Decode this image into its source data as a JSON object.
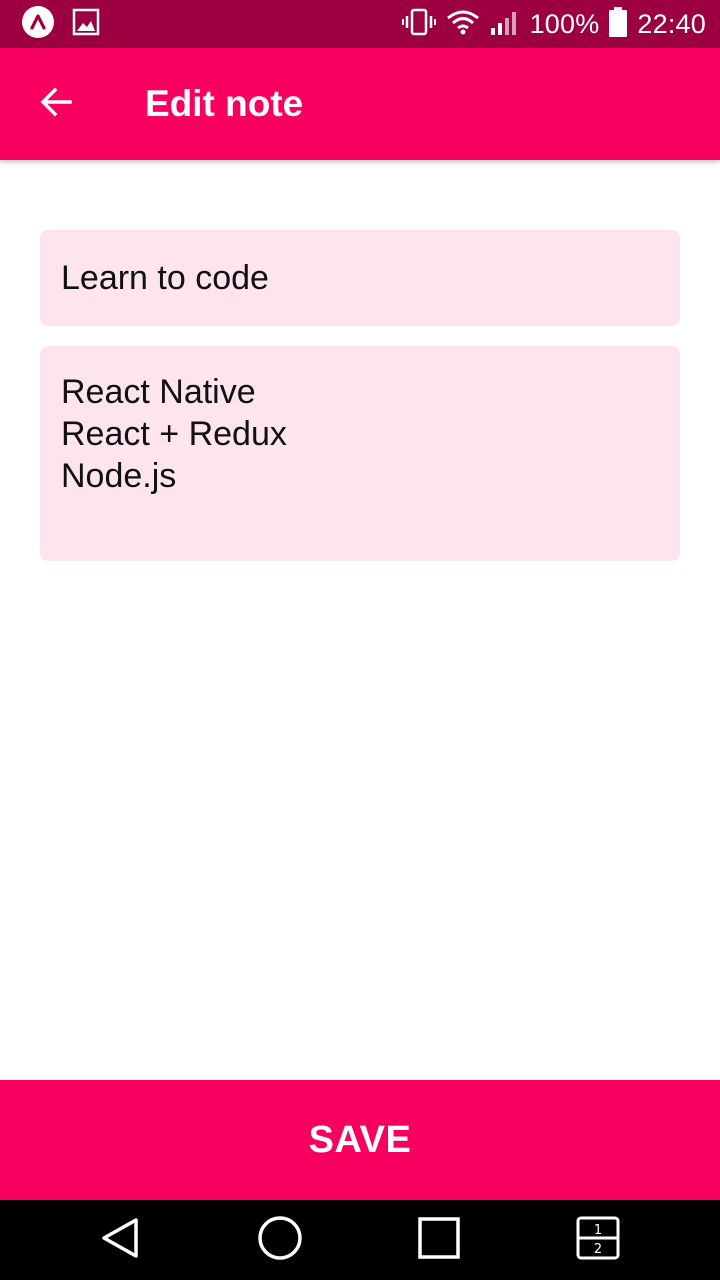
{
  "status_bar": {
    "battery": "100%",
    "time": "22:40"
  },
  "app_bar": {
    "title": "Edit note"
  },
  "note": {
    "title": "Learn to code",
    "body_lines": [
      "React Native",
      "React + Redux",
      "Node.js"
    ]
  },
  "save_button": {
    "label": "SAVE"
  },
  "nav_bar": {
    "icons": [
      "back-icon",
      "home-icon",
      "recents-icon",
      "split-screen-icon"
    ]
  },
  "colors": {
    "status_bar": "#9c0040",
    "accent": "#f7005f",
    "field_background": "#fde4ee"
  }
}
